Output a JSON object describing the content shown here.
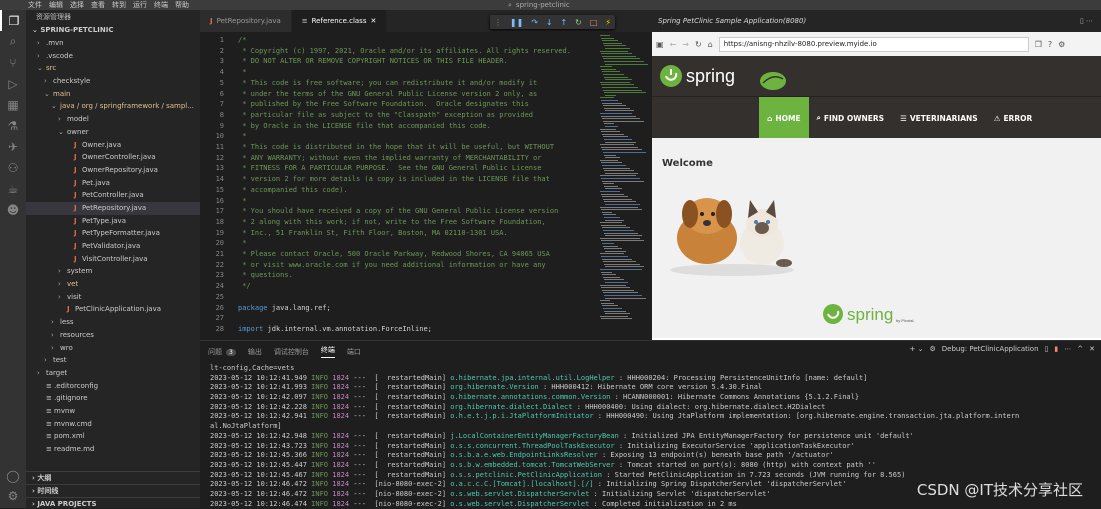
{
  "menu": [
    "文件",
    "编辑",
    "选择",
    "查看",
    "转到",
    "运行",
    "终端",
    "帮助"
  ],
  "window_title": "spring-petclinic",
  "sidebar": {
    "title": "资源管理器",
    "project": "SPRING-PETCLINIC",
    "tree": [
      {
        "label": ".mvn",
        "depth": 1,
        "chev": "›",
        "type": "dir"
      },
      {
        "label": ".vscode",
        "depth": 1,
        "chev": "›",
        "type": "dir"
      },
      {
        "label": "src",
        "depth": 1,
        "chev": "⌄",
        "type": "dir",
        "mod": true
      },
      {
        "label": "checkstyle",
        "depth": 2,
        "chev": "›",
        "type": "dir"
      },
      {
        "label": "main",
        "depth": 2,
        "chev": "⌄",
        "type": "dir",
        "mod": true
      },
      {
        "label": "java / org / springframework / sampl...",
        "depth": 3,
        "chev": "⌄",
        "type": "dir",
        "mod": true
      },
      {
        "label": "model",
        "depth": 4,
        "chev": "›",
        "type": "dir"
      },
      {
        "label": "owner",
        "depth": 4,
        "chev": "⌄",
        "type": "dir"
      },
      {
        "label": "Owner.java",
        "depth": 5,
        "chev": "",
        "type": "java"
      },
      {
        "label": "OwnerController.java",
        "depth": 5,
        "chev": "",
        "type": "java"
      },
      {
        "label": "OwnerRepository.java",
        "depth": 5,
        "chev": "",
        "type": "java"
      },
      {
        "label": "Pet.java",
        "depth": 5,
        "chev": "",
        "type": "java"
      },
      {
        "label": "PetController.java",
        "depth": 5,
        "chev": "",
        "type": "java"
      },
      {
        "label": "PetRepository.java",
        "depth": 5,
        "chev": "",
        "type": "java",
        "selected": true
      },
      {
        "label": "PetType.java",
        "depth": 5,
        "chev": "",
        "type": "java"
      },
      {
        "label": "PetTypeFormatter.java",
        "depth": 5,
        "chev": "",
        "type": "java"
      },
      {
        "label": "PetValidator.java",
        "depth": 5,
        "chev": "",
        "type": "java"
      },
      {
        "label": "VisitController.java",
        "depth": 5,
        "chev": "",
        "type": "java"
      },
      {
        "label": "system",
        "depth": 4,
        "chev": "›",
        "type": "dir"
      },
      {
        "label": "vet",
        "depth": 4,
        "chev": "›",
        "type": "dir",
        "mod": true
      },
      {
        "label": "visit",
        "depth": 4,
        "chev": "›",
        "type": "dir"
      },
      {
        "label": "PetClinicApplication.java",
        "depth": 4,
        "chev": "",
        "type": "java"
      },
      {
        "label": "less",
        "depth": 3,
        "chev": "›",
        "type": "dir"
      },
      {
        "label": "resources",
        "depth": 3,
        "chev": "›",
        "type": "dir"
      },
      {
        "label": "wro",
        "depth": 3,
        "chev": "›",
        "type": "dir"
      },
      {
        "label": "test",
        "depth": 2,
        "chev": "›",
        "type": "dir"
      },
      {
        "label": "target",
        "depth": 1,
        "chev": "›",
        "type": "dir"
      },
      {
        "label": ".editorconfig",
        "depth": 1,
        "chev": "",
        "type": "file"
      },
      {
        "label": ".gitignore",
        "depth": 1,
        "chev": "",
        "type": "file"
      },
      {
        "label": "mvnw",
        "depth": 1,
        "chev": "",
        "type": "file"
      },
      {
        "label": "mvnw.cmd",
        "depth": 1,
        "chev": "",
        "type": "file"
      },
      {
        "label": "pom.xml",
        "depth": 1,
        "chev": "",
        "type": "file"
      },
      {
        "label": "readme.md",
        "depth": 1,
        "chev": "",
        "type": "file"
      }
    ],
    "footer": [
      "大纲",
      "时间线",
      "JAVA PROJECTS"
    ]
  },
  "tabs": [
    {
      "label": "PetRepository.java",
      "type": "java"
    },
    {
      "label": "Reference.class",
      "type": "class",
      "active": true
    }
  ],
  "editor": {
    "lines": [
      {
        "n": "1",
        "t": "/*",
        "c": "cm"
      },
      {
        "n": "2",
        "t": " * Copyright (c) 1997, 2021, Oracle and/or its affiliates. All rights reserved.",
        "c": "cm"
      },
      {
        "n": "3",
        "t": " * DO NOT ALTER OR REMOVE COPYRIGHT NOTICES OR THIS FILE HEADER.",
        "c": "cm"
      },
      {
        "n": "4",
        "t": " *",
        "c": "cm"
      },
      {
        "n": "5",
        "t": " * This code is free software; you can redistribute it and/or modify it",
        "c": "cm"
      },
      {
        "n": "6",
        "t": " * under the terms of the GNU General Public License version 2 only, as",
        "c": "cm"
      },
      {
        "n": "7",
        "t": " * published by the Free Software Foundation.  Oracle designates this",
        "c": "cm"
      },
      {
        "n": "8",
        "t": " * particular file as subject to the \"Classpath\" exception as provided",
        "c": "cm"
      },
      {
        "n": "9",
        "t": " * by Oracle in the LICENSE file that accompanied this code.",
        "c": "cm"
      },
      {
        "n": "10",
        "t": " *",
        "c": "cm"
      },
      {
        "n": "11",
        "t": " * This code is distributed in the hope that it will be useful, but WITHOUT",
        "c": "cm"
      },
      {
        "n": "12",
        "t": " * ANY WARRANTY; without even the implied warranty of MERCHANTABILITY or",
        "c": "cm"
      },
      {
        "n": "13",
        "t": " * FITNESS FOR A PARTICULAR PURPOSE.  See the GNU General Public License",
        "c": "cm"
      },
      {
        "n": "14",
        "t": " * version 2 for more details (a copy is included in the LICENSE file that",
        "c": "cm"
      },
      {
        "n": "15",
        "t": " * accompanied this code).",
        "c": "cm"
      },
      {
        "n": "16",
        "t": " *",
        "c": "cm"
      },
      {
        "n": "17",
        "t": " * You should have received a copy of the GNU General Public License version",
        "c": "cm"
      },
      {
        "n": "18",
        "t": " * 2 along with this work; if not, write to the Free Software Foundation,",
        "c": "cm"
      },
      {
        "n": "19",
        "t": " * Inc., 51 Franklin St, Fifth Floor, Boston, MA 02110-1301 USA.",
        "c": "cm"
      },
      {
        "n": "20",
        "t": " *",
        "c": "cm"
      },
      {
        "n": "21",
        "t": " * Please contact Oracle, 500 Oracle Parkway, Redwood Shores, CA 94065 USA",
        "c": "cm"
      },
      {
        "n": "22",
        "t": " * or visit www.oracle.com if you need additional information or have any",
        "c": "cm"
      },
      {
        "n": "23",
        "t": " * questions.",
        "c": "cm"
      },
      {
        "n": "24",
        "t": " */",
        "c": "cm"
      },
      {
        "n": "25",
        "t": "",
        "c": "tx"
      },
      {
        "n": "26",
        "t": "package java.lang.ref;",
        "c": "pkg"
      },
      {
        "n": "27",
        "t": "",
        "c": "tx"
      },
      {
        "n": "28",
        "t": "import jdk.internal.vm.annotation.ForceInline;",
        "c": "imp"
      }
    ]
  },
  "browser": {
    "title": "Spring PetClinic Sample Application(8080)",
    "url": "https://anisng-nhzilv-8080.preview.myide.io",
    "brand": "spring",
    "nav": [
      {
        "label": "HOME",
        "icon": "home-icon",
        "active": true
      },
      {
        "label": "FIND OWNERS",
        "icon": "search-icon"
      },
      {
        "label": "VETERINARIANS",
        "icon": "list-icon"
      },
      {
        "label": "ERROR",
        "icon": "warning-icon"
      }
    ],
    "welcome": "Welcome",
    "footer_brand": "spring",
    "footer_by": "by Pivotal."
  },
  "panel": {
    "tabs": [
      {
        "label": "问题",
        "badge": "3"
      },
      {
        "label": "输出"
      },
      {
        "label": "调试控制台"
      },
      {
        "label": "终端",
        "active": true
      },
      {
        "label": "端口"
      }
    ],
    "session": "Debug: PetClinicApplication",
    "first_line": "lt-config,Cache=vets",
    "log": [
      {
        "ts": "2023-05-12 10:12:41.949",
        "lvl": "INFO",
        "pid": "1824",
        "th": "---  [  restartedMain]",
        "cls": "o.hibernate.jpa.internal.util.LogHelper",
        "msg": ": HHH000204: Processing PersistenceUnitInfo [name: default]"
      },
      {
        "ts": "2023-05-12 10:12:41.993",
        "lvl": "INFO",
        "pid": "1824",
        "th": "---  [  restartedMain]",
        "cls": "org.hibernate.Version",
        "msg": ": HHH000412: Hibernate ORM core version 5.4.30.Final"
      },
      {
        "ts": "2023-05-12 10:12:42.097",
        "lvl": "INFO",
        "pid": "1824",
        "th": "---  [  restartedMain]",
        "cls": "o.hibernate.annotations.common.Version",
        "msg": ": HCANN000001: Hibernate Commons Annotations {5.1.2.Final}"
      },
      {
        "ts": "2023-05-12 10:12:42.228",
        "lvl": "INFO",
        "pid": "1824",
        "th": "---  [  restartedMain]",
        "cls": "org.hibernate.dialect.Dialect",
        "msg": ": HHH000400: Using dialect: org.hibernate.dialect.H2Dialect"
      },
      {
        "ts": "2023-05-12 10:12:42.941",
        "lvl": "INFO",
        "pid": "1824",
        "th": "---  [  restartedMain]",
        "cls": "o.h.e.t.j.p.i.JtaPlatformInitiator",
        "msg": ": HHH000490: Using JtaPlatform implementation: [org.hibernate.engine.transaction.jta.platform.intern"
      },
      {
        "ts": "",
        "lvl": "",
        "pid": "",
        "th": "",
        "cls": "",
        "msg": "al.NoJtaPlatform]"
      },
      {
        "ts": "2023-05-12 10:12:42.948",
        "lvl": "INFO",
        "pid": "1824",
        "th": "---  [  restartedMain]",
        "cls": "j.LocalContainerEntityManagerFactoryBean",
        "msg": ": Initialized JPA EntityManagerFactory for persistence unit 'default'"
      },
      {
        "ts": "2023-05-12 10:12:43.723",
        "lvl": "INFO",
        "pid": "1824",
        "th": "---  [  restartedMain]",
        "cls": "o.s.s.concurrent.ThreadPoolTaskExecutor",
        "msg": ": Initializing ExecutorService 'applicationTaskExecutor'"
      },
      {
        "ts": "2023-05-12 10:12:45.366",
        "lvl": "INFO",
        "pid": "1824",
        "th": "---  [  restartedMain]",
        "cls": "o.s.b.a.e.web.EndpointLinksResolver",
        "msg": ": Exposing 13 endpoint(s) beneath base path '/actuator'"
      },
      {
        "ts": "2023-05-12 10:12:45.447",
        "lvl": "INFO",
        "pid": "1824",
        "th": "---  [  restartedMain]",
        "cls": "o.s.b.w.embedded.tomcat.TomcatWebServer",
        "msg": ": Tomcat started on port(s): 8080 (http) with context path ''"
      },
      {
        "ts": "2023-05-12 10:12:45.467",
        "lvl": "INFO",
        "pid": "1824",
        "th": "---  [  restartedMain]",
        "cls": "o.s.s.petclinic.PetClinicApplication",
        "msg": ": Started PetClinicApplication in 7.723 seconds (JVM running for 8.565)"
      },
      {
        "ts": "2023-05-12 10:12:46.472",
        "lvl": "INFO",
        "pid": "1824",
        "th": "---  [nio-8080-exec-2]",
        "cls": "o.a.c.c.C.[Tomcat].[localhost].[/]",
        "msg": ": Initializing Spring DispatcherServlet 'dispatcherServlet'"
      },
      {
        "ts": "2023-05-12 10:12:46.472",
        "lvl": "INFO",
        "pid": "1824",
        "th": "---  [nio-8080-exec-2]",
        "cls": "o.s.web.servlet.DispatcherServlet",
        "msg": ": Initializing Servlet 'dispatcherServlet'"
      },
      {
        "ts": "2023-05-12 10:12:46.474",
        "lvl": "INFO",
        "pid": "1824",
        "th": "---  [nio-8080-exec-2]",
        "cls": "o.s.web.servlet.DispatcherServlet",
        "msg": ": Completed initialization in 2 ms"
      }
    ]
  },
  "watermark": "CSDN @IT技术分享社区",
  "colors": {
    "spring_green": "#6db33f",
    "petclinic_header": "#34302d",
    "java_icon": "#e06c4a"
  }
}
